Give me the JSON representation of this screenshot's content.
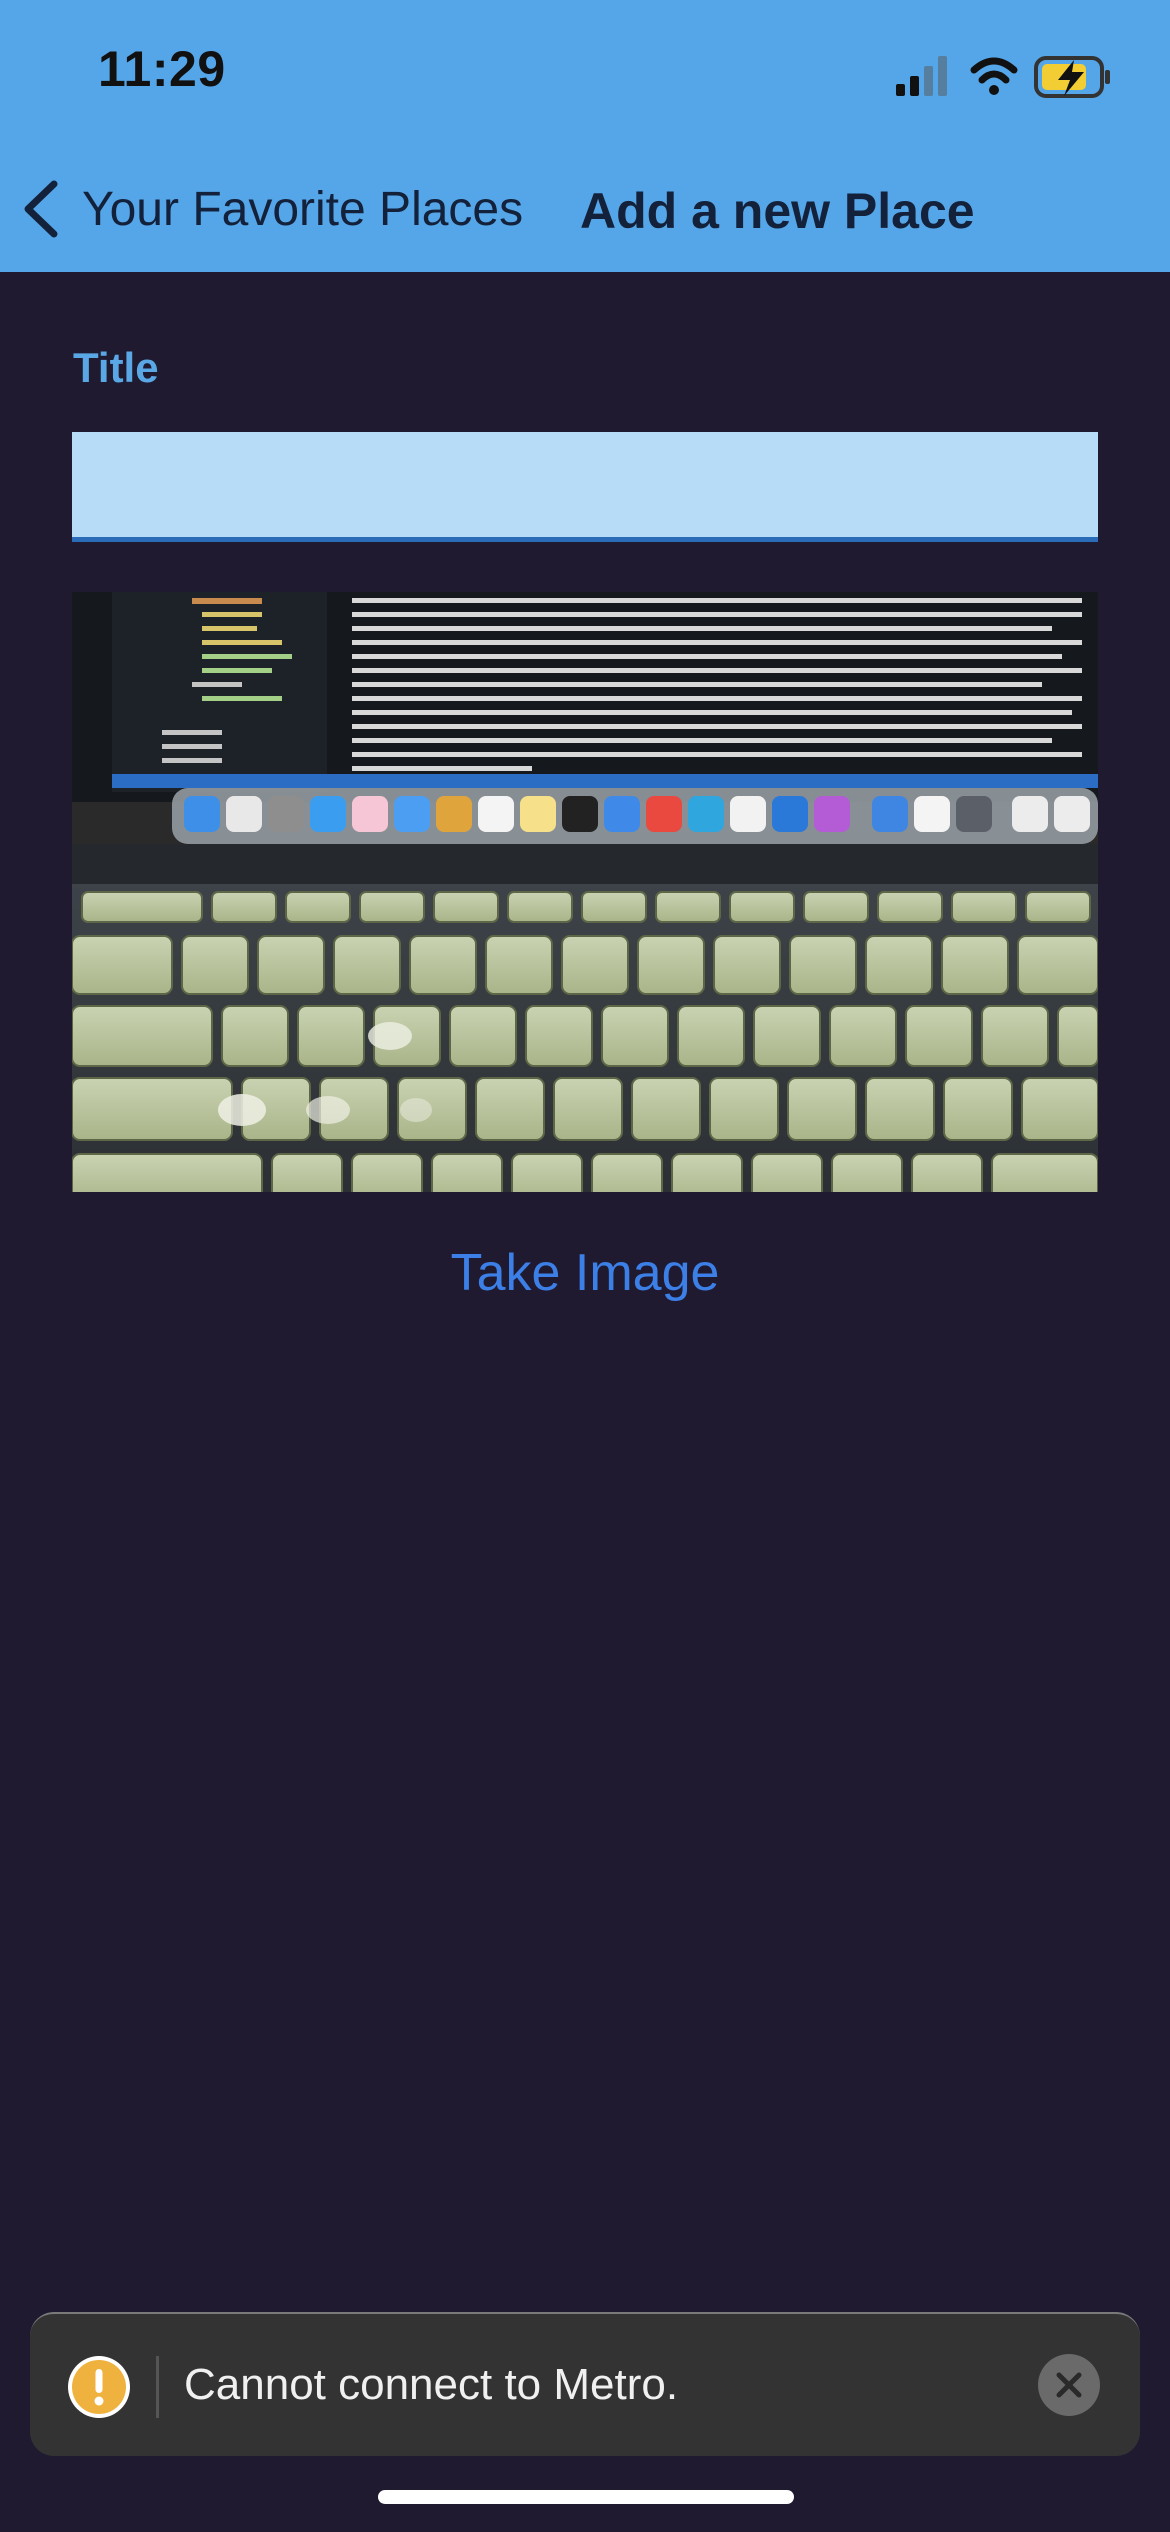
{
  "status_bar": {
    "time": "11:29"
  },
  "nav": {
    "back_label": "Your Favorite Places",
    "title": "Add a new Place"
  },
  "form": {
    "title_label": "Title",
    "title_value": "",
    "take_image_label": "Take Image"
  },
  "image_preview": {
    "icon": "photo-of-laptop-keyboard-and-screen"
  },
  "toast": {
    "message": "Cannot connect to Metro.",
    "icon": "warning-icon",
    "close_icon": "close-icon"
  },
  "colors": {
    "header": "#55a6e8",
    "background": "#1f1a30",
    "accent_label": "#5aa7e6",
    "input_bg": "#b6dcf7",
    "input_border": "#2b6cb8",
    "link": "#3c7fe6",
    "toast_bg": "#333333",
    "warning": "#f0b23e"
  }
}
